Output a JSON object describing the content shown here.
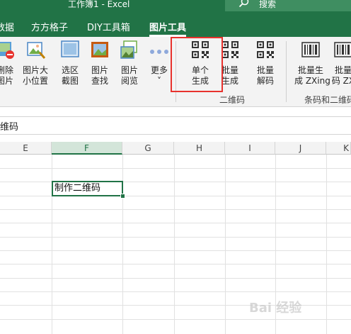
{
  "window": {
    "title": "工作簿1  -  Excel",
    "search_label": "搜索"
  },
  "tabs": [
    {
      "label": "数据"
    },
    {
      "label": "方方格子"
    },
    {
      "label": "DIY工具箱"
    },
    {
      "label": "图片工具",
      "active": true
    }
  ],
  "ribbon": {
    "buttons": [
      {
        "label1": "删除",
        "label2": "图片",
        "icon": "delete-picture-icon"
      },
      {
        "label1": "图片大",
        "label2": "小位置",
        "icon": "picture-size-icon"
      },
      {
        "label1": "选区",
        "label2": "截图",
        "icon": "screenshot-icon"
      },
      {
        "label1": "图片",
        "label2": "查找",
        "icon": "picture-find-icon"
      },
      {
        "label1": "图片",
        "label2": "阅览",
        "icon": "picture-view-icon"
      },
      {
        "label1": "更多",
        "label2": "˅",
        "icon": "more-icon"
      },
      {
        "label1": "单个",
        "label2": "生成",
        "icon": "qr-code-icon"
      },
      {
        "label1": "批量",
        "label2": "生成",
        "icon": "qr-code-batch-icon"
      },
      {
        "label1": "批量",
        "label2": "解码",
        "icon": "qr-decode-icon"
      },
      {
        "label1": "批量生",
        "label2": "成 ZXing",
        "icon": "barcode-icon"
      },
      {
        "label1": "批量",
        "label2": "码 ZX",
        "icon": "barcode-decode-icon"
      }
    ],
    "groups": [
      {
        "label": "二维码"
      },
      {
        "label": "条码和二维码"
      }
    ]
  },
  "formula_bar": {
    "text": "维码"
  },
  "columns": [
    "E",
    "F",
    "G",
    "H",
    "I",
    "J",
    "K"
  ],
  "selected_column": "F",
  "cell": {
    "value": "制作二维码"
  },
  "watermark": "Bai 经验",
  "colors": {
    "excel_green": "#217346",
    "highlight_red": "#e8322d"
  }
}
